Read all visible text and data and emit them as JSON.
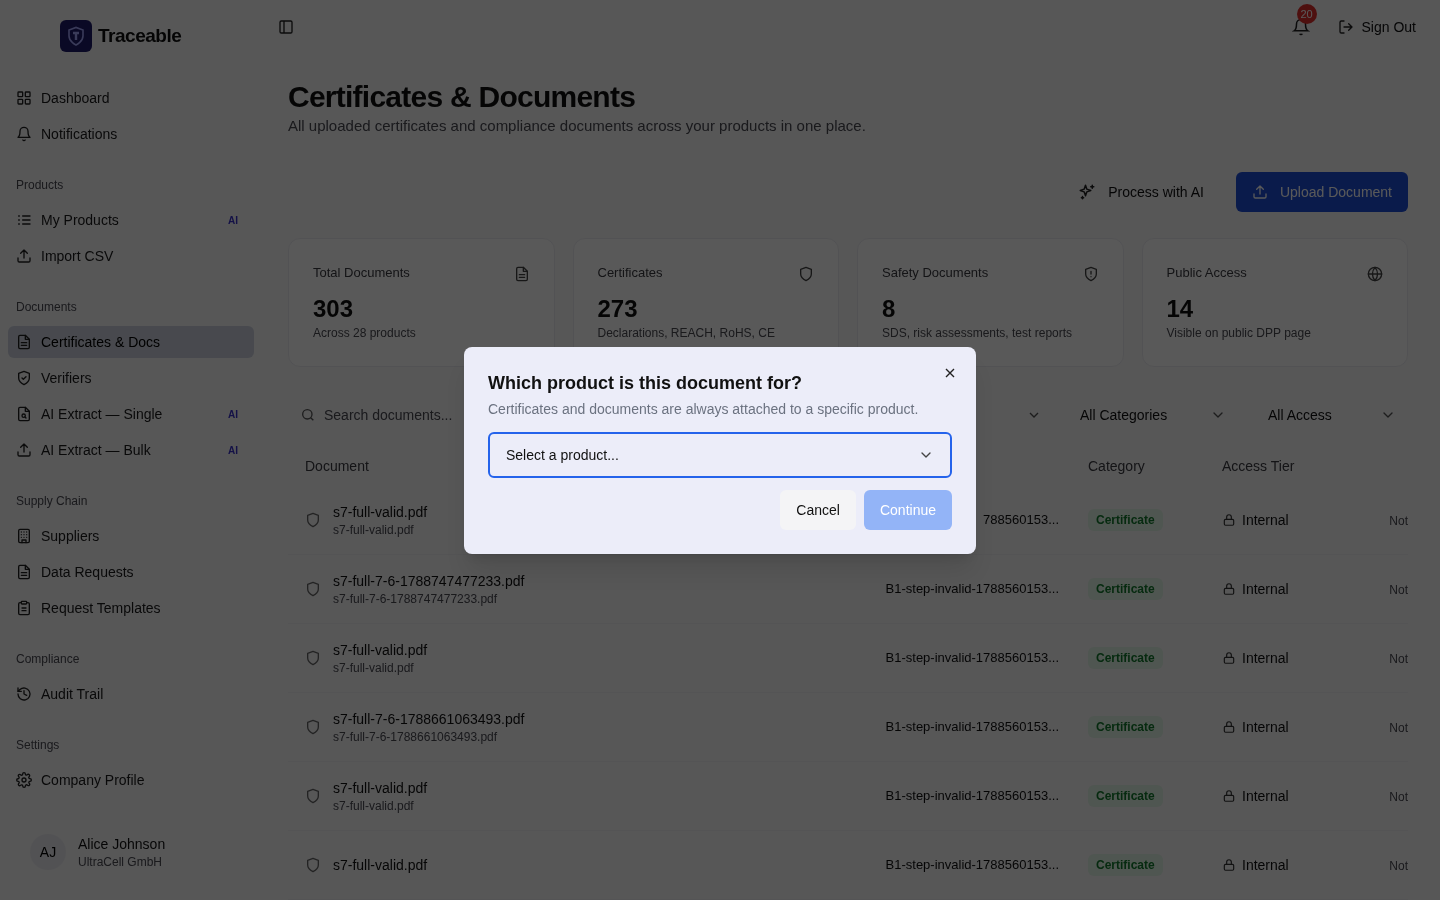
{
  "brand": {
    "name": "Traceable"
  },
  "sidebar": {
    "sections": [
      {
        "items": [
          {
            "label": "Dashboard",
            "selected": false
          },
          {
            "label": "Notifications",
            "selected": false
          }
        ]
      },
      {
        "title": "Products",
        "items": [
          {
            "label": "My Products",
            "badge": "AI",
            "selected": false
          },
          {
            "label": "Import CSV",
            "selected": false
          }
        ]
      },
      {
        "title": "Documents",
        "items": [
          {
            "label": "Certificates & Docs",
            "selected": true
          },
          {
            "label": "Verifiers",
            "selected": false
          },
          {
            "label": "AI Extract — Single",
            "badge": "AI",
            "selected": false
          },
          {
            "label": "AI Extract — Bulk",
            "badge": "AI",
            "selected": false
          }
        ]
      },
      {
        "title": "Supply Chain",
        "items": [
          {
            "label": "Suppliers",
            "selected": false
          },
          {
            "label": "Data Requests",
            "selected": false
          },
          {
            "label": "Request Templates",
            "selected": false
          }
        ]
      },
      {
        "title": "Compliance",
        "items": [
          {
            "label": "Audit Trail",
            "selected": false
          }
        ]
      },
      {
        "title": "Settings",
        "items": [
          {
            "label": "Company Profile",
            "selected": false
          }
        ]
      }
    ],
    "user": {
      "initials": "AJ",
      "name": "Alice Johnson",
      "company": "UltraCell GmbH"
    }
  },
  "header": {
    "notification_count": "20",
    "sign_out": "Sign Out"
  },
  "page": {
    "title": "Certificates & Documents",
    "subtitle": "All uploaded certificates and compliance documents across your products in one place.",
    "actions": {
      "secondary": "Process with AI",
      "primary": "Upload Document"
    }
  },
  "stats": [
    {
      "label": "Total Documents",
      "value": "303",
      "note": "Across 28 products"
    },
    {
      "label": "Certificates",
      "value": "273",
      "note": "Declarations, REACH, RoHS, CE"
    },
    {
      "label": "Safety Documents",
      "value": "8",
      "note": "SDS, risk assessments, test reports"
    },
    {
      "label": "Public Access",
      "value": "14",
      "note": "Visible on public DPP page"
    }
  ],
  "filters": {
    "search_placeholder": "Search documents...",
    "category": "All Categories",
    "access": "All Access"
  },
  "table": {
    "columns": [
      "Document",
      "Category",
      "Access Tier"
    ],
    "rows": [
      {
        "name": "s7-full-valid.pdf",
        "file": "s7-full-valid.pdf",
        "product": "788560153...",
        "category": "Certificate",
        "access": "Internal",
        "column_6": "Not"
      },
      {
        "name": "s7-full-7-6-1788747477233.pdf",
        "file": "s7-full-7-6-1788747477233.pdf",
        "product": "B1-step-invalid-1788560153...",
        "category": "Certificate",
        "access": "Internal",
        "column_6": "Not"
      },
      {
        "name": "s7-full-valid.pdf",
        "file": "s7-full-valid.pdf",
        "product": "B1-step-invalid-1788560153...",
        "category": "Certificate",
        "access": "Internal",
        "column_6": "Not"
      },
      {
        "name": "s7-full-7-6-1788661063493.pdf",
        "file": "s7-full-7-6-1788661063493.pdf",
        "product": "B1-step-invalid-1788560153...",
        "category": "Certificate",
        "access": "Internal",
        "column_6": "Not"
      },
      {
        "name": "s7-full-valid.pdf",
        "file": "s7-full-valid.pdf",
        "product": "B1-step-invalid-1788560153...",
        "category": "Certificate",
        "access": "Internal",
        "column_6": "Not"
      },
      {
        "name": "s7-full-valid.pdf",
        "product": "B1-step-invalid-1788560153...",
        "category": "Certificate",
        "access": "Internal",
        "column_6": "Not"
      }
    ]
  },
  "dialog": {
    "title": "Which product is this document for?",
    "description": "Certificates and documents are always attached to a specific product.",
    "select_placeholder": "Select a product...",
    "cancel": "Cancel",
    "continue": "Continue",
    "continue_disabled": true
  }
}
